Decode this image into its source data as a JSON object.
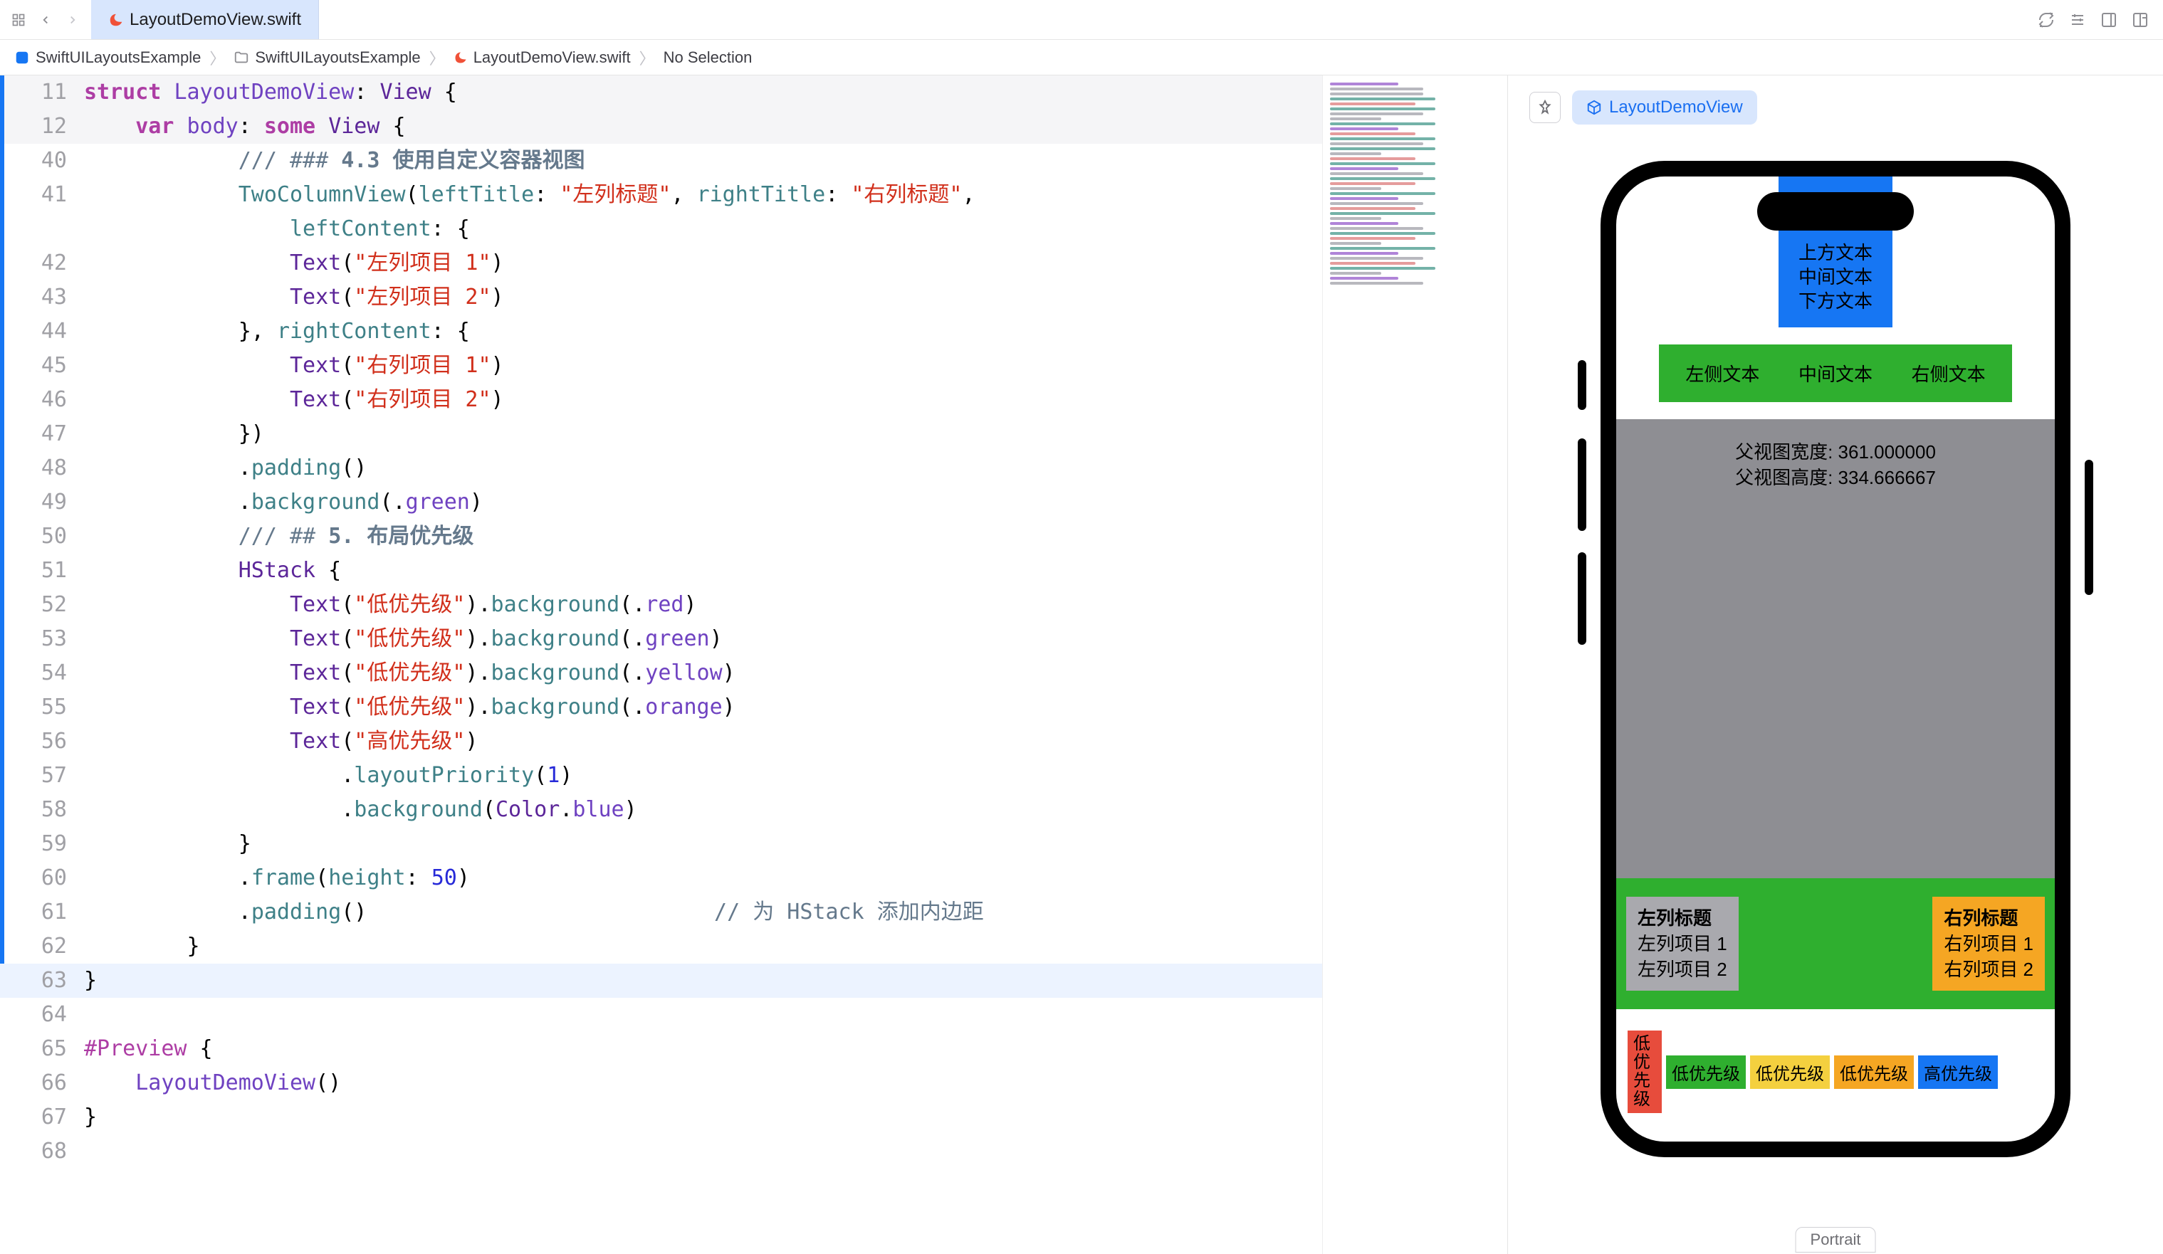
{
  "tab": {
    "file": "LayoutDemoView.swift"
  },
  "breadcrumb": {
    "project": "SwiftUILayoutsExample",
    "group": "SwiftUILayoutsExample",
    "file": "LayoutDemoView.swift",
    "selection": "No Selection"
  },
  "code": {
    "l11": {
      "n": "11",
      "struct": "struct",
      "name": "LayoutDemoView",
      "view": "View"
    },
    "l12": {
      "n": "12",
      "varkw": "var",
      "body": "body",
      "some": "some",
      "view": "View"
    },
    "l40": {
      "n": "40",
      "c1": "/// ### ",
      "c2": "4.3 使用自定义容器视图"
    },
    "l41": {
      "n": "41",
      "fn": "TwoColumnView",
      "lt": "leftTitle",
      "lv": "\"左列标题\"",
      "rt": "rightTitle",
      "rv": "\"右列标题\"",
      "lc": "leftContent"
    },
    "l42": {
      "n": "42",
      "t": "Text",
      "s": "\"左列项目 1\""
    },
    "l43": {
      "n": "43",
      "t": "Text",
      "s": "\"左列项目 2\""
    },
    "l44": {
      "n": "44",
      "rc": "rightContent"
    },
    "l45": {
      "n": "45",
      "t": "Text",
      "s": "\"右列项目 1\""
    },
    "l46": {
      "n": "46",
      "t": "Text",
      "s": "\"右列项目 2\""
    },
    "l47": {
      "n": "47"
    },
    "l48": {
      "n": "48",
      "p": "padding"
    },
    "l49": {
      "n": "49",
      "b": "background",
      "g": "green"
    },
    "l50": {
      "n": "50",
      "c1": "/// ## ",
      "c2": "5. 布局优先级"
    },
    "l51": {
      "n": "51",
      "h": "HStack"
    },
    "l52": {
      "n": "52",
      "t": "Text",
      "s": "\"低优先级\"",
      "b": "background",
      "c": "red"
    },
    "l53": {
      "n": "53",
      "t": "Text",
      "s": "\"低优先级\"",
      "b": "background",
      "c": "green"
    },
    "l54": {
      "n": "54",
      "t": "Text",
      "s": "\"低优先级\"",
      "b": "background",
      "c": "yellow"
    },
    "l55": {
      "n": "55",
      "t": "Text",
      "s": "\"低优先级\"",
      "b": "background",
      "c": "orange"
    },
    "l56": {
      "n": "56",
      "t": "Text",
      "s": "\"高优先级\""
    },
    "l57": {
      "n": "57",
      "lp": "layoutPriority",
      "v": "1"
    },
    "l58": {
      "n": "58",
      "b": "background",
      "col": "Color",
      "blue": "blue"
    },
    "l59": {
      "n": "59"
    },
    "l60": {
      "n": "60",
      "f": "frame",
      "h": "height",
      "v": "50"
    },
    "l61": {
      "n": "61",
      "p": "padding",
      "cm": "// 为 HStack 添加内边距"
    },
    "l62": {
      "n": "62"
    },
    "l63": {
      "n": "63"
    },
    "l64": {
      "n": "64"
    },
    "l65": {
      "n": "65",
      "pv": "#Preview"
    },
    "l66": {
      "n": "66",
      "fn": "LayoutDemoView"
    },
    "l67": {
      "n": "67"
    },
    "l68": {
      "n": "68"
    }
  },
  "preview": {
    "pill": "LayoutDemoView",
    "blue": {
      "a": "上方文本",
      "b": "中间文本",
      "c": "下方文本"
    },
    "row": {
      "a": "左侧文本",
      "b": "中间文本",
      "c": "右侧文本"
    },
    "gray": {
      "w": "父视图宽度: 361.000000",
      "h": "父视图高度: 334.666667"
    },
    "left": {
      "title": "左列标题",
      "i1": "左列项目 1",
      "i2": "左列项目 2"
    },
    "right": {
      "title": "右列标题",
      "i1": "右列项目 1",
      "i2": "右列项目 2"
    },
    "priority": {
      "red": "低优先级",
      "green": "低优先级",
      "yellow": "低优先级",
      "orange": "低优先级",
      "blue": "高优先级"
    },
    "orientation": "Portrait"
  }
}
